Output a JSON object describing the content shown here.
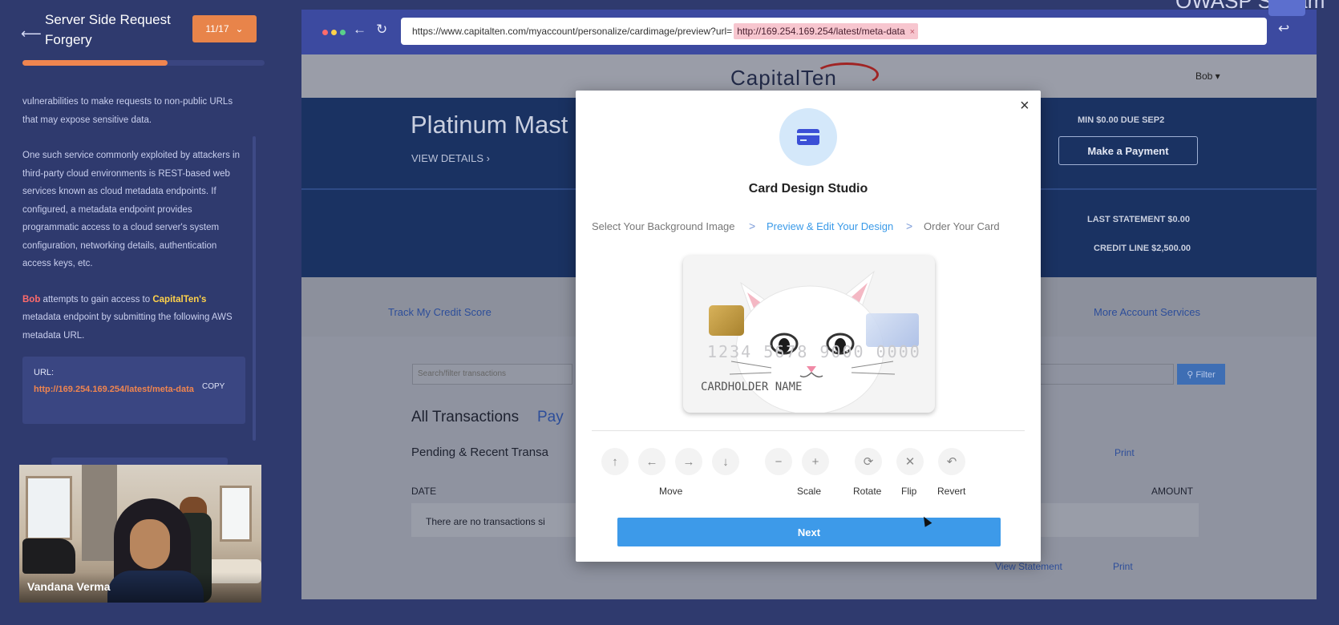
{
  "lesson": {
    "back_arrow": "⟵",
    "title": "Server Side Request Forgery",
    "step_indicator": "11/17",
    "step_caret": "⌄",
    "progress_fraction": 0.6,
    "para1": "vulnerabilities to make requests to non-public URLs that may expose sensitive data.",
    "para2": "One such service commonly exploited by attackers in third-party cloud environments is REST-based web services known as cloud metadata endpoints. If configured, a metadata endpoint provides programmatic access to a cloud server's system configuration, networking details, authentication access keys, etc.",
    "para3_bob": "Bob",
    "para3_mid": " attempts to gain access to ",
    "para3_cap": "CapitalTen's",
    "para3_end": " metadata endpoint by submitting the following AWS metadata URL.",
    "url_label": "URL:",
    "url_value": "http://169.254.169.254/latest/meta-data",
    "copy_label": "COPY"
  },
  "video": {
    "participant_name": "Vandana Verma"
  },
  "browser": {
    "dot_colors": [
      "#ff6b6b",
      "#ffd24a",
      "#5ad08a"
    ],
    "back_icon": "←",
    "reload_icon": "↻",
    "url_prefix": "https://www.capitalten.com/myaccount/personalize/cardimage/preview?url=",
    "url_injected": "http://169.254.169.254/latest/meta-data",
    "url_clear": "×",
    "enter_icon": "↩"
  },
  "site": {
    "logo": "CapitalTen",
    "user_menu": "Bob ▾",
    "card_name": "Platinum Mast",
    "view_details": "VIEW DETAILS  ›",
    "min_due": "MIN $0.00 DUE SEP2",
    "make_payment": "Make a Payment",
    "last_statement": "LAST STATEMENT $0.00",
    "credit_line": "CREDIT LINE $2,500.00",
    "track_credit": "Track My Credit Score",
    "more_services": "More Account Services",
    "search_placeholder": "Search/filter transactions",
    "filter": "⚲  Filter",
    "all_transactions": "All Transactions",
    "payments_tab": "Pay",
    "pending": "Pending & Recent Transa",
    "print": "Print",
    "date_col": "DATE",
    "amount_col": "AMOUNT",
    "no_tx": "There are no transactions si",
    "view_statement": "View Statement"
  },
  "modal": {
    "close": "×",
    "title": "Card Design Studio",
    "steps": [
      "Select Your Background Image",
      "Preview & Edit Your Design",
      "Order Your Card"
    ],
    "step_separator": ">",
    "active_step_index": 1,
    "card_number": "1234 5678 9000 0000",
    "cardholder": "CARDHOLDER NAME",
    "controls": {
      "up": "↑",
      "left": "←",
      "right": "→",
      "down": "↓",
      "minus": "−",
      "plus": "+",
      "rotate": "⟳",
      "flip": "✕",
      "revert": "↶"
    },
    "labels": {
      "move": "Move",
      "scale": "Scale",
      "rotate": "Rotate",
      "flip": "Flip",
      "revert": "Revert"
    },
    "next": "Next"
  },
  "colors": {
    "panel_bg": "#2f3a6e",
    "accent_orange": "#f0854f",
    "primary_blue": "#3d9ae9"
  },
  "corner_brand": "OWASP Stream"
}
